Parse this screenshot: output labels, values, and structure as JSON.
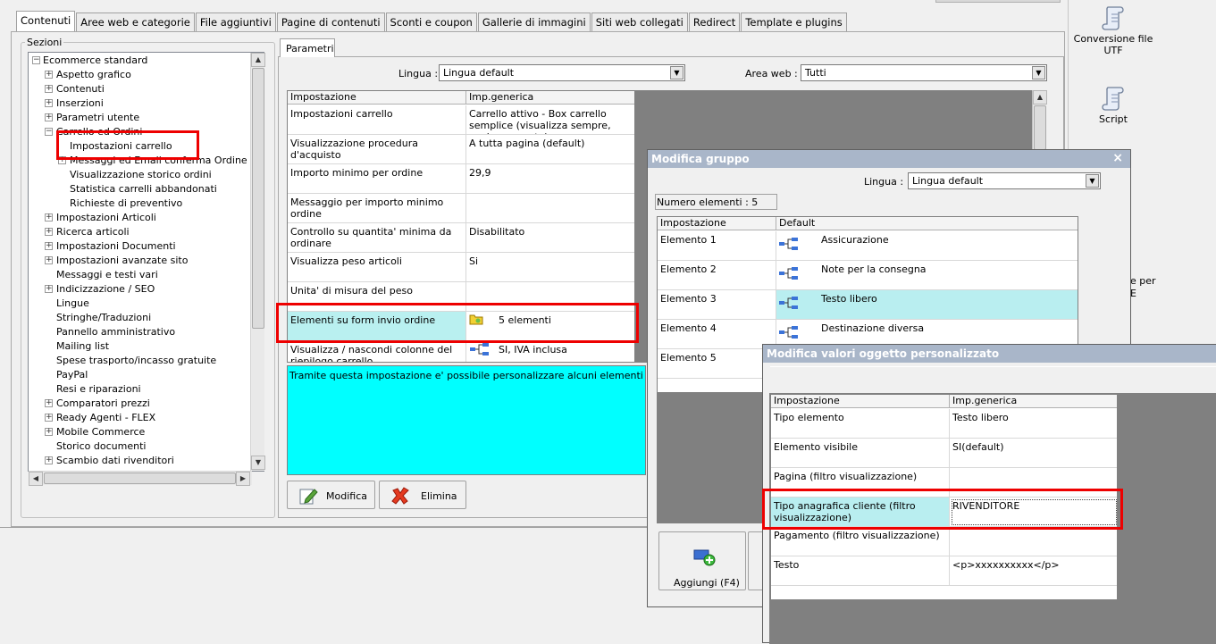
{
  "tabs": [
    "Contenuti",
    "Aree web e categorie",
    "File aggiuntivi",
    "Pagine di contenuti",
    "Sconti e coupon",
    "Gallerie di immagini",
    "Siti web collegati",
    "Redirect",
    "Template e plugins"
  ],
  "sections_label": "Sezioni",
  "tree": [
    {
      "label": "Ecommerce standard",
      "level": 0,
      "exp": "−"
    },
    {
      "label": "Aspetto grafico",
      "level": 1,
      "exp": "+"
    },
    {
      "label": "Contenuti",
      "level": 1,
      "exp": "+"
    },
    {
      "label": "Inserzioni",
      "level": 1,
      "exp": "+"
    },
    {
      "label": "Parametri utente",
      "level": 1,
      "exp": "+"
    },
    {
      "label": "Carrello ed Ordini",
      "level": 1,
      "exp": "−"
    },
    {
      "label": "Impostazioni carrello",
      "level": 2,
      "exp": ""
    },
    {
      "label": "Messaggi ed Email conferma Ordine",
      "level": 2,
      "exp": "+"
    },
    {
      "label": "Visualizzazione storico ordini",
      "level": 2,
      "exp": ""
    },
    {
      "label": "Statistica carrelli abbandonati",
      "level": 2,
      "exp": ""
    },
    {
      "label": "Richieste di preventivo",
      "level": 2,
      "exp": ""
    },
    {
      "label": "Impostazioni Articoli",
      "level": 1,
      "exp": "+"
    },
    {
      "label": "Ricerca articoli",
      "level": 1,
      "exp": "+"
    },
    {
      "label": "Impostazioni Documenti",
      "level": 1,
      "exp": "+"
    },
    {
      "label": "Impostazioni avanzate sito",
      "level": 1,
      "exp": "+"
    },
    {
      "label": "Messaggi e testi vari",
      "level": 1,
      "exp": ""
    },
    {
      "label": "Indicizzazione / SEO",
      "level": 1,
      "exp": "+"
    },
    {
      "label": "Lingue",
      "level": 1,
      "exp": ""
    },
    {
      "label": "Stringhe/Traduzioni",
      "level": 1,
      "exp": ""
    },
    {
      "label": "Pannello amministrativo",
      "level": 1,
      "exp": ""
    },
    {
      "label": "Mailing list",
      "level": 1,
      "exp": ""
    },
    {
      "label": "Spese trasporto/incasso gratuite",
      "level": 1,
      "exp": ""
    },
    {
      "label": "PayPal",
      "level": 1,
      "exp": ""
    },
    {
      "label": "Resi e riparazioni",
      "level": 1,
      "exp": ""
    },
    {
      "label": "Comparatori prezzi",
      "level": 1,
      "exp": "+"
    },
    {
      "label": "Ready Agenti - FLEX",
      "level": 1,
      "exp": "+"
    },
    {
      "label": "Mobile Commerce",
      "level": 1,
      "exp": "+"
    },
    {
      "label": "Storico documenti",
      "level": 1,
      "exp": ""
    },
    {
      "label": "Scambio dati rivenditori",
      "level": 1,
      "exp": "+"
    }
  ],
  "params_tab": "Parametri",
  "lingua_label": "Lingua :",
  "lingua_value": "Lingua default",
  "area_label": "Area web :",
  "area_value": "Tutti",
  "main_grid": {
    "headers": [
      "Impostazione",
      "Imp.generica"
    ],
    "rows": [
      [
        "Impostazioni carrello",
        "Carrello attivo - Box carrello semplice (visualizza sempre, anche se vuoto)"
      ],
      [
        "Visualizzazione procedura d'acquisto",
        "A tutta pagina (default)"
      ],
      [
        "Importo minimo per ordine",
        "29,9"
      ],
      [
        "Messaggio per importo minimo ordine",
        ""
      ],
      [
        "Controllo su quantita' minima da ordinare",
        "Disabilitato"
      ],
      [
        "Visualizza peso articoli",
        "Si"
      ],
      [
        "Unita' di misura del peso",
        ""
      ],
      [
        "Elementi su form invio ordine",
        "5 elementi"
      ],
      [
        "Visualizza / nascondi colonne del riepilogo carrello",
        "SI, IVA inclusa"
      ]
    ]
  },
  "description": "Tramite questa impostazione e' possibile personalizzare alcuni elementi che compong",
  "btn_modifica": "Modifica",
  "btn_elimina": "Elimina",
  "right_tools": [
    {
      "line1": "Conversione file",
      "line2": "UTF"
    },
    {
      "line1": "Script",
      "line2": ""
    }
  ],
  "right_partial": [
    "e per",
    "E"
  ],
  "dialog1": {
    "title": "Modifica gruppo",
    "close": "×",
    "lingua_label": "Lingua :",
    "lingua_value": "Lingua default",
    "count_label": "Numero elementi : 5",
    "headers": [
      "Impostazione",
      "Default"
    ],
    "rows": [
      [
        "Elemento 1",
        "Assicurazione"
      ],
      [
        "Elemento 2",
        "Note per la consegna"
      ],
      [
        "Elemento 3",
        "Testo libero"
      ],
      [
        "Elemento 4",
        "Destinazione diversa"
      ],
      [
        "Elemento 5",
        ""
      ]
    ],
    "add_button": "Aggiungi (F4)"
  },
  "dialog2": {
    "title": "Modifica valori oggetto personalizzato",
    "headers": [
      "Impostazione",
      "Imp.generica"
    ],
    "rows": [
      [
        "Tipo elemento",
        "Testo libero"
      ],
      [
        "Elemento visibile",
        "SI(default)"
      ],
      [
        "Pagina (filtro visualizzazione)",
        ""
      ],
      [
        "Tipo anagrafica cliente (filtro visualizzazione)",
        "RIVENDITORE"
      ],
      [
        "Pagamento (filtro visualizzazione)",
        ""
      ],
      [
        "Testo",
        "<p>xxxxxxxxxx</p>"
      ]
    ]
  }
}
